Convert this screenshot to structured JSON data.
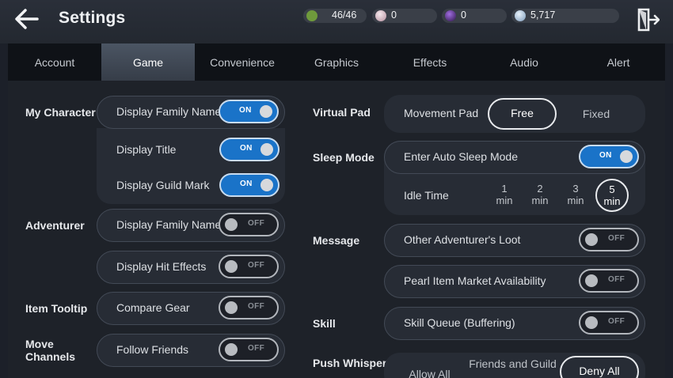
{
  "header": {
    "title": "Settings",
    "back_icon": "arrow-left-icon",
    "exit_icon": "exit-door-icon",
    "resources": [
      {
        "icon": "energy-icon",
        "value": "46/46"
      },
      {
        "icon": "pearl-icon",
        "value": "0"
      },
      {
        "icon": "black-stone-icon",
        "value": "0"
      },
      {
        "icon": "silver-coin-icon",
        "value": "5,717"
      }
    ]
  },
  "tabs": [
    {
      "label": "Account"
    },
    {
      "label": "Game",
      "active": true
    },
    {
      "label": "Convenience"
    },
    {
      "label": "Graphics"
    },
    {
      "label": "Effects"
    },
    {
      "label": "Audio"
    },
    {
      "label": "Alert"
    }
  ],
  "left": {
    "my_character": {
      "label": "My Character",
      "display_family_name": {
        "label": "Display Family Name",
        "state": "ON"
      },
      "display_title": {
        "label": "Display Title",
        "state": "ON"
      },
      "display_guild_mark": {
        "label": "Display Guild Mark",
        "state": "ON"
      }
    },
    "adventurer": {
      "label": "Adventurer",
      "display_family_name": {
        "label": "Display Family Name",
        "state": "OFF"
      },
      "display_hit_effects": {
        "label": "Display Hit Effects",
        "state": "OFF"
      }
    },
    "item_tooltip": {
      "label": "Item Tooltip",
      "compare_gear": {
        "label": "Compare Gear",
        "state": "OFF"
      }
    },
    "move_channels": {
      "label_line1": "Move",
      "label_line2": "Channels",
      "follow_friends": {
        "label": "Follow Friends",
        "state": "OFF"
      }
    }
  },
  "right": {
    "virtual_pad": {
      "label": "Virtual Pad",
      "movement_pad": "Movement Pad",
      "options": [
        "Free",
        "Fixed"
      ],
      "selected": "Free"
    },
    "sleep_mode": {
      "label": "Sleep Mode",
      "enter_auto_sleep": {
        "label": "Enter Auto Sleep Mode",
        "state": "ON"
      },
      "idle_time_label": "Idle Time",
      "idle_options": [
        {
          "num": "1",
          "unit": "min"
        },
        {
          "num": "2",
          "unit": "min"
        },
        {
          "num": "3",
          "unit": "min"
        },
        {
          "num": "5",
          "unit": "min"
        }
      ],
      "idle_selected": "5"
    },
    "message": {
      "label": "Message",
      "other_loot": {
        "label": "Other Adventurer's Loot",
        "state": "OFF"
      },
      "pearl_market": {
        "label": "Pearl Item Market Availability",
        "state": "OFF"
      }
    },
    "skill": {
      "label": "Skill",
      "skill_queue": {
        "label": "Skill Queue (Buffering)",
        "state": "OFF"
      }
    },
    "push_whisper": {
      "label": "Push Whisper",
      "options": [
        "Allow All",
        "Friends and Guild",
        "Deny All"
      ],
      "selected": "Deny All"
    }
  }
}
